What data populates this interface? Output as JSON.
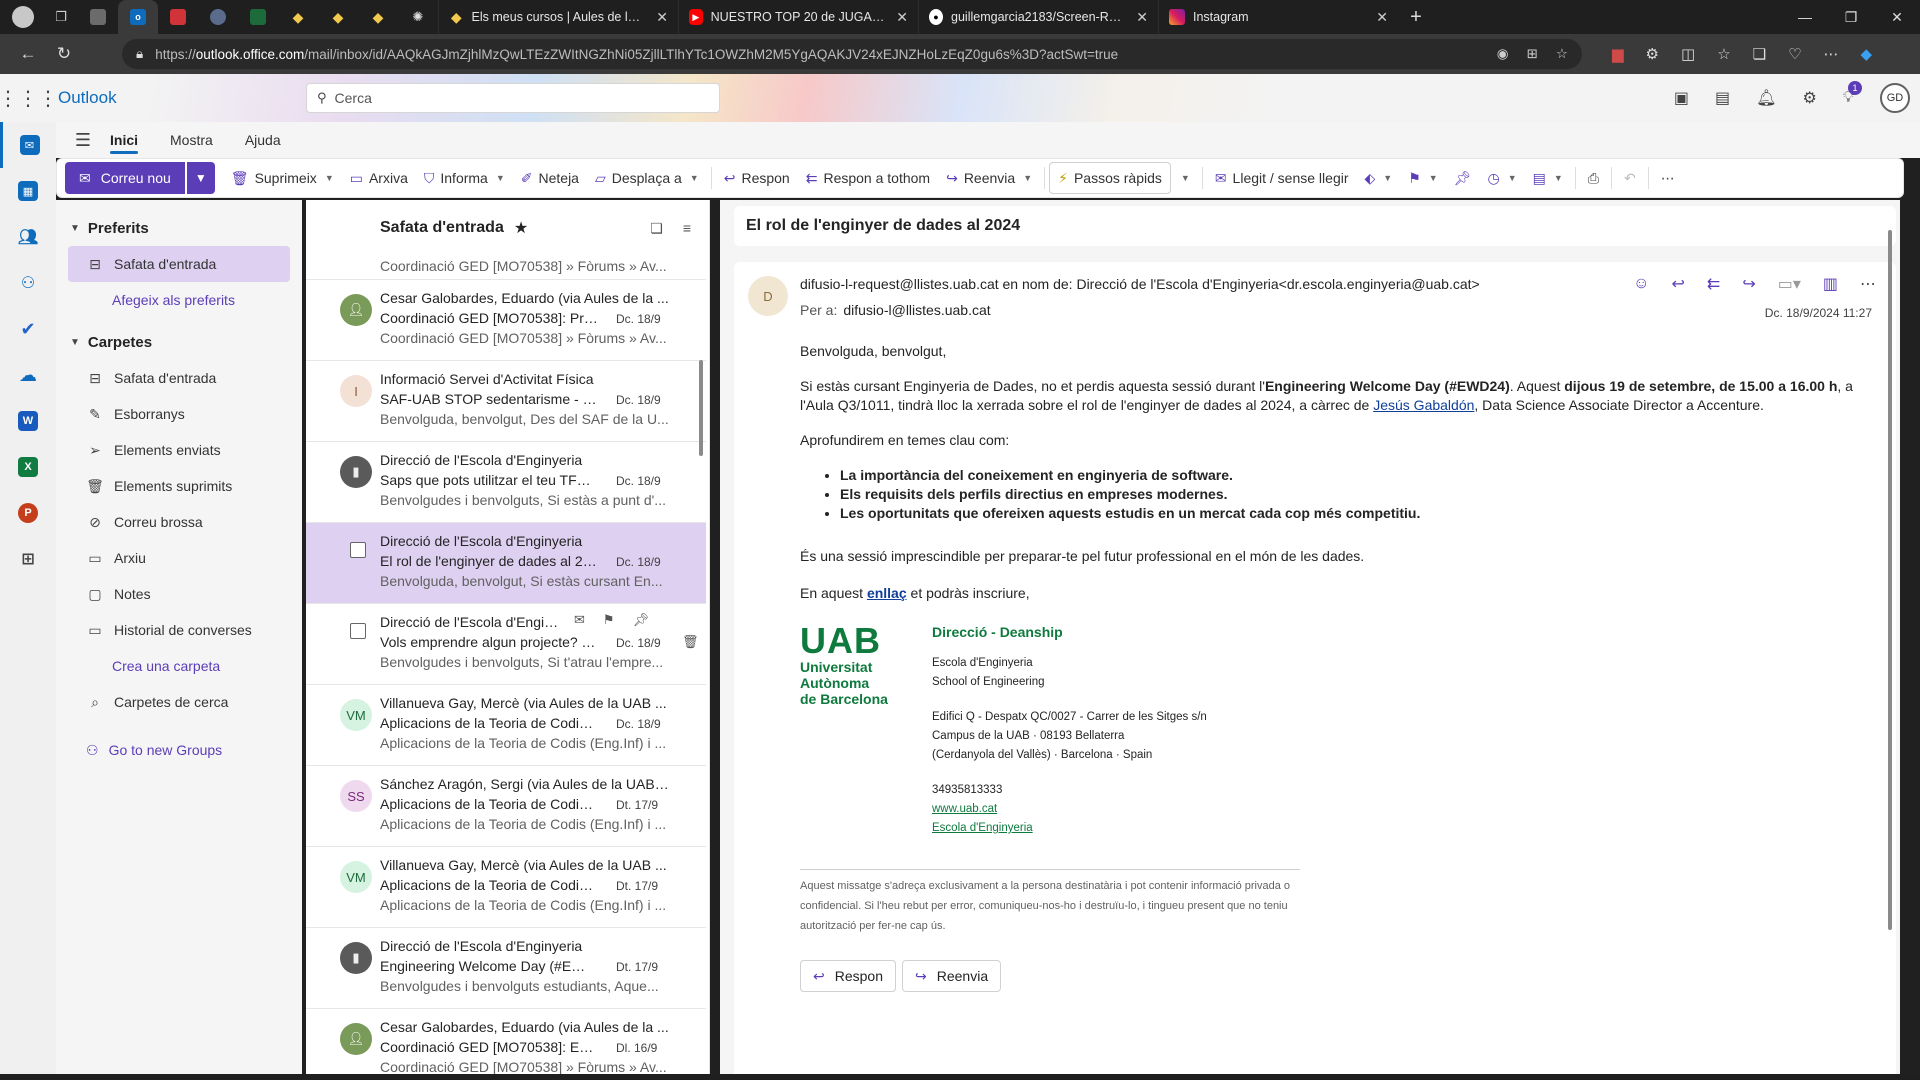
{
  "browser": {
    "tabs": [
      {
        "label": "Els meus cursos | Aules de la UAB",
        "favicon": "diamond-icon"
      },
      {
        "label": "NUESTRO TOP 20 de JUGADORES",
        "favicon": "youtube-icon"
      },
      {
        "label": "guillemgarcia2183/Screen-Recorder",
        "favicon": "github-icon"
      },
      {
        "label": "Instagram",
        "favicon": "instagram-icon"
      }
    ],
    "close_glyph": "✕",
    "url_host": "outlook.office.com",
    "url_path": "/mail/inbox/id/AAQkAGJmZjhlMzQwLTEzZWItNGZhNi05ZjllLTlhYTc1OWZhM2M5YgAQAKJV24xEJNZHoLzEqZ0gu6s%3D?actSwt=true",
    "url_scheme": "https://"
  },
  "outlook": {
    "brand": "Outlook",
    "search_placeholder": "Cerca",
    "notification_count": "1",
    "avatar_initials": "GD"
  },
  "ribbon": {
    "tabs": [
      "Inici",
      "Mostra",
      "Ajuda"
    ],
    "new_mail": "Correu nou",
    "actions": {
      "delete": "Suprimeix",
      "archive": "Arxiva",
      "report": "Informa",
      "sweep": "Neteja",
      "move": "Desplaça a",
      "reply": "Respon",
      "reply_all": "Respon a tothom",
      "forward": "Reenvia",
      "quick_steps": "Passos ràpids",
      "read_unread": "Llegit / sense llegir"
    }
  },
  "folders": {
    "favorites_header": "Preferits",
    "favorites": [
      {
        "label": "Safata d'entrada",
        "icon": "inbox-icon"
      }
    ],
    "add_favorite": "Afegeix als preferits",
    "folders_header": "Carpetes",
    "items": [
      {
        "label": "Safata d'entrada",
        "icon": "inbox-icon"
      },
      {
        "label": "Esborranys",
        "icon": "pencil-icon"
      },
      {
        "label": "Elements enviats",
        "icon": "send-icon"
      },
      {
        "label": "Elements suprimits",
        "icon": "trash-icon"
      },
      {
        "label": "Correu brossa",
        "icon": "junk-icon"
      },
      {
        "label": "Arxiu",
        "icon": "archive-icon"
      },
      {
        "label": "Notes",
        "icon": "note-icon"
      },
      {
        "label": "Historial de converses",
        "icon": "folder-icon"
      }
    ],
    "create_folder": "Crea una carpeta",
    "search_folders": "Carpetes de cerca",
    "groups_link": "Go to new Groups"
  },
  "message_list": {
    "title": "Safata d'entrada",
    "top_partial_preview": "Coordinació GED [MO70538] » Fòrums » Av...",
    "messages": [
      {
        "sender": "Cesar Galobardes, Eduardo (via Aules de la ...",
        "subject": "Coordinació GED [MO70538]: Pre...",
        "date": "Dc. 18/9",
        "preview": "Coordinació GED [MO70538] » Fòrums » Av...",
        "avatar": "photo",
        "avatar_color": "#7a9a5a"
      },
      {
        "sender": "Informació Servei d'Activitat Física",
        "subject": "SAF-UAB STOP sedentarisme - For...",
        "date": "Dc. 18/9",
        "preview": "Benvolguda, benvolgut, Des del SAF de la U...",
        "avatar": "I",
        "avatar_color": "#f3e1d6"
      },
      {
        "sender": "Direcció de l'Escola d'Enginyeria",
        "subject": "Saps que pots utilitzar el teu TFG ...",
        "date": "Dc. 18/9",
        "preview": "Benvolgudes i benvolguts, Si estàs a punt d'...",
        "avatar": "photo",
        "avatar_color": "#5a5a5a"
      },
      {
        "sender": "Direcció de l'Escola d'Enginyeria",
        "subject": "El rol de l'enginyer de dades al 20...",
        "date": "Dc. 18/9",
        "preview": "Benvolguda, benvolgut, Si estàs cursant En...",
        "avatar": "checkbox",
        "avatar_color": ""
      },
      {
        "sender": "Direcció de l'Escola d'Engin...",
        "subject": "Vols emprendre algun projecte? T...",
        "date": "Dc. 18/9",
        "preview": "Benvolgudes i benvolguts, Si t'atrau l'empre...",
        "avatar": "checkbox",
        "avatar_color": ""
      },
      {
        "sender": "Villanueva Gay, Mercè (via Aules de la UAB ...",
        "subject": "Aplicacions de la Teoria de Codis (...",
        "date": "Dc. 18/9",
        "preview": "Aplicacions de la Teoria de Codis (Eng.Inf) i ...",
        "avatar": "VM",
        "avatar_color": "#d6f2e1"
      },
      {
        "sender": "Sánchez Aragón, Sergi (via Aules de la UAB ...",
        "subject": "Aplicacions de la Teoria de Codis (...",
        "date": "Dt. 17/9",
        "preview": "Aplicacions de la Teoria de Codis (Eng.Inf) i ...",
        "avatar": "SS",
        "avatar_color": "#efd9ef"
      },
      {
        "sender": "Villanueva Gay, Mercè (via Aules de la UAB ...",
        "subject": "Aplicacions de la Teoria de Codis (...",
        "date": "Dt. 17/9",
        "preview": "Aplicacions de la Teoria de Codis (Eng.Inf) i ...",
        "avatar": "VM",
        "avatar_color": "#d6f2e1"
      },
      {
        "sender": "Direcció de l'Escola d'Enginyeria",
        "subject": "Engineering Welcome Day (#EWD...",
        "date": "Dt. 17/9",
        "preview": "Benvolgudes i benvolguts estudiants, Aque...",
        "avatar": "photo",
        "avatar_color": "#5a5a5a"
      },
      {
        "sender": "Cesar Galobardes, Eduardo (via Aules de la ...",
        "subject": "Coordinació GED [MO70538]: Engi...",
        "date": "Dl. 16/9",
        "preview": "Coordinació GED [MO70538] » Fòrums » Av...",
        "avatar": "photo",
        "avatar_color": "#7a9a5a"
      }
    ]
  },
  "reading": {
    "subject": "El rol de l'enginyer de dades al 2024",
    "sender_initial": "D",
    "from": "difusio-l-request@llistes.uab.cat en nom de: Direcció de l'Escola d'Enginyeria<dr.escola.enginyeria@uab.cat>",
    "to_label": "Per a:",
    "to": "difusio-l@llistes.uab.cat",
    "date": "Dc. 18/9/2024 11:27",
    "greeting": "Benvolguda, benvolgut,",
    "p1_a": "Si estàs cursant Enginyeria de Dades, no et perdis aquesta sessió durant l'",
    "p1_b": "Engineering Welcome Day (#EWD24)",
    "p1_c": ". Aquest ",
    "p1_d": "dijous 19 de setembre, de 15.00 a 16.00 h",
    "p1_e": ", a l'Aula Q3/1011, tindrà lloc la xerrada sobre el rol de l'enginyer de dades al 2024, a càrrec de ",
    "p1_link": "Jesús Gabaldón",
    "p1_f": ", Data Science Associate Director a Accenture.",
    "p2": "Aprofundirem en temes clau com:",
    "bullets": [
      "La importància del coneixement en enginyeria de software.",
      "Els requisits dels perfils directius en empreses modernes.",
      "Les oportunitats que ofereixen aquests estudis en un mercat cada cop més competitiu."
    ],
    "p3": "És una sessió imprescindible per preparar-te pel futur professional en el món de les dades.",
    "p4_a": "En aquest ",
    "p4_link": "enllaç",
    "p4_b": " et podràs inscriure,",
    "logo_big": "UAB",
    "logo_l1": "Universitat",
    "logo_l2": "Autònoma",
    "logo_l3": "de Barcelona",
    "sig_title": "Direcció - Deanship",
    "sig_l1": "Escola d'Enginyeria",
    "sig_l2": "School of Engineering",
    "sig_l3": "Edifici Q - Despatx QC/0027 - Carrer de les Sitges s/n",
    "sig_l4": "Campus de la UAB · 08193 Bellaterra",
    "sig_l5": "(Cerdanyola del Vallès) · Barcelona · Spain",
    "sig_phone": "34935813333",
    "sig_web": "www.uab.cat",
    "sig_school": "Escola d'Enginyeria",
    "disclaimer": "Aquest missatge s'adreça exclusivament a la persona destinatària i pot contenir informació privada o confidencial. Si l'heu rebut per error, comuniqueu-nos-ho i destruïu-lo, i tingueu present que no teniu autorització per fer-ne cap ús.",
    "reply_btn": "Respon",
    "forward_btn": "Reenvia"
  },
  "colors": {
    "accent": "#5b3db8",
    "selection": "#ddd0f1",
    "outlook_blue": "#0f6cbd",
    "uab_green": "#0e7a3e"
  }
}
